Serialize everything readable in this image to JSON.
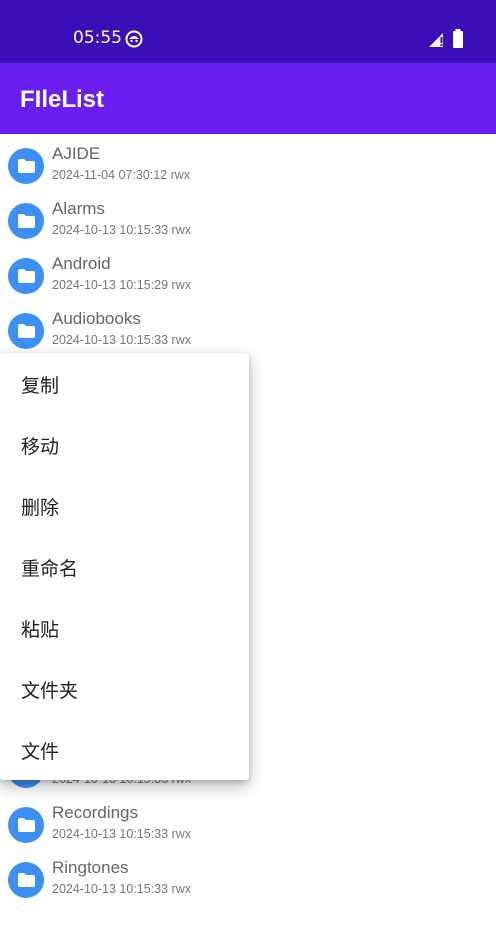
{
  "status_bar": {
    "time": "05:55",
    "icons": [
      "notification-icon",
      "signal-icon",
      "battery-icon"
    ],
    "bg_color": "#3a0fb8"
  },
  "app_bar": {
    "title": "FIleList",
    "bg_color": "#6a1ef2"
  },
  "files": [
    {
      "name": "AJIDE",
      "meta": "2024-11-04 07:30:12 rwx",
      "icon": "folder-icon"
    },
    {
      "name": "Alarms",
      "meta": "2024-10-13 10:15:33 rwx",
      "icon": "folder-icon"
    },
    {
      "name": "Android",
      "meta": "2024-10-13 10:15:29 rwx",
      "icon": "folder-icon"
    },
    {
      "name": "Audiobooks",
      "meta": "2024-10-13 10:15:33 rwx",
      "icon": "folder-icon"
    },
    {
      "name": "",
      "meta": "2024-10-13 10:15:33 rwx",
      "icon": "folder-icon"
    },
    {
      "name": "Recordings",
      "meta": "2024-10-13 10:15:33 rwx",
      "icon": "folder-icon"
    },
    {
      "name": "Ringtones",
      "meta": "2024-10-13 10:15:33 rwx",
      "icon": "folder-icon"
    }
  ],
  "context_menu": {
    "items": [
      "复制",
      "移动",
      "删除",
      "重命名",
      "粘贴",
      "文件夹",
      "文件"
    ]
  },
  "colors": {
    "folder_icon_bg": "#3b8ff5"
  }
}
